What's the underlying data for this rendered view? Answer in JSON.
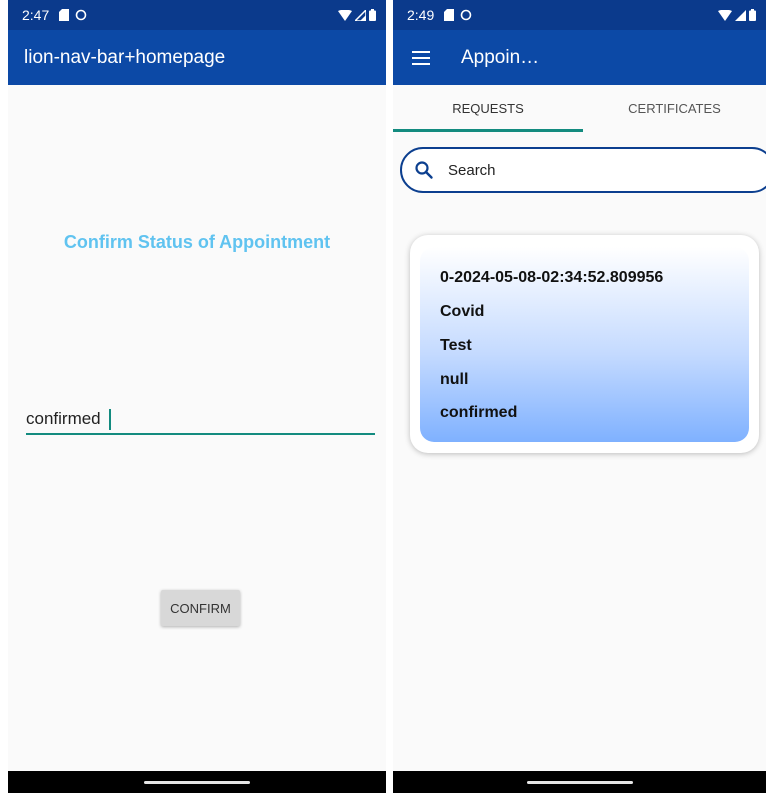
{
  "left_screen": {
    "status_bar": {
      "time": "2:47"
    },
    "app_bar": {
      "title": "lion-nav-bar+homepage"
    },
    "heading": "Confirm Status of Appointment",
    "status_input": {
      "value": "confirmed"
    },
    "confirm_button": "CONFIRM"
  },
  "right_screen": {
    "status_bar": {
      "time": "2:49"
    },
    "app_bar": {
      "title": "Appoin…",
      "menu_icon": "menu-icon"
    },
    "tabs": [
      {
        "label": "REQUESTS",
        "selected": true
      },
      {
        "label": "CERTIFICATES",
        "selected": false
      }
    ],
    "search": {
      "placeholder": "Search",
      "icon": "search-icon"
    },
    "card": {
      "lines": [
        "0-2024-05-08-02:34:52.809956",
        "Covid",
        "Test",
        "null",
        "confirmed"
      ]
    }
  },
  "colors": {
    "status_bar": "#0b3a8c",
    "app_bar": "#0c49a6",
    "heading": "#60c3f0",
    "accent": "#138b7f",
    "search_border": "#0c3f8f"
  }
}
